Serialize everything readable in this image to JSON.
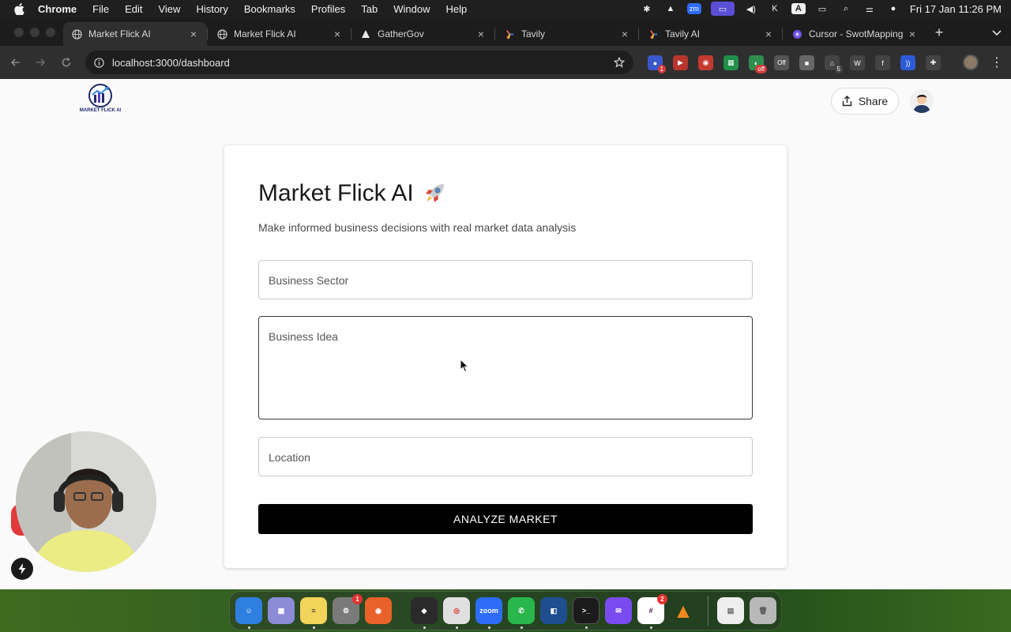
{
  "menubar": {
    "app_name": "Chrome",
    "menus": [
      "File",
      "Edit",
      "View",
      "History",
      "Bookmarks",
      "Profiles",
      "Tab",
      "Window",
      "Help"
    ],
    "status_icons": [
      "gear-icon",
      "vlc-icon",
      "zoom-icon",
      "screen-share-icon",
      "volume-icon",
      "k-icon",
      "a-icon",
      "battery-icon",
      "search-icon",
      "control-center-icon",
      "siri-icon"
    ],
    "clock": "Fri 17 Jan  11:26 PM"
  },
  "tabs": [
    {
      "title": "Market Flick AI",
      "favicon": "globe-icon",
      "active": true
    },
    {
      "title": "Market Flick AI",
      "favicon": "globe-icon",
      "active": false
    },
    {
      "title": "GatherGov",
      "favicon": "triangle-icon",
      "active": false
    },
    {
      "title": "Tavily",
      "favicon": "tavily-icon",
      "active": false
    },
    {
      "title": "Tavily AI",
      "favicon": "tavily-icon",
      "active": false
    },
    {
      "title": "Cursor - SwotMapping",
      "favicon": "cursor-icon",
      "active": false
    }
  ],
  "address_bar": {
    "url": "localhost:3000/dashboard"
  },
  "extensions": [
    {
      "name": "extension-icon",
      "badge": "1",
      "color": "#3a58c9"
    },
    {
      "name": "video-extension-icon",
      "badge": "",
      "color": "#b8342c"
    },
    {
      "name": "camera-extension-icon",
      "badge": "",
      "color": "#c43a2f"
    },
    {
      "name": "sheets-extension-icon",
      "badge": "",
      "color": "#1f8f4a"
    },
    {
      "name": "off-extension-icon",
      "badge": "off",
      "color": "#2f8d4e"
    },
    {
      "name": "off-toggle-extension-icon",
      "badge": "Off",
      "color": "#555555"
    },
    {
      "name": "box-extension-icon",
      "badge": "",
      "color": "#666666"
    },
    {
      "name": "home-extension-icon",
      "badge": "5",
      "color": "#555555"
    },
    {
      "name": "w-extension-icon",
      "badge": "",
      "color": "#555555"
    },
    {
      "name": "facebook-extension-icon",
      "badge": "",
      "color": "#555555"
    },
    {
      "name": "audio-extension-icon",
      "badge": "",
      "color": "#2d5bd6"
    },
    {
      "name": "puzzle-extension-icon",
      "badge": "",
      "color": "#555555"
    }
  ],
  "page": {
    "logo_text": "MARKET FLICK AI",
    "share_label": "Share",
    "card": {
      "title": "Market Flick AI",
      "subtitle": "Make informed business decisions with real market data analysis",
      "sector_placeholder": "Business Sector",
      "idea_placeholder": "Business Idea",
      "location_placeholder": "Location",
      "analyze_label": "ANALYZE MARKET"
    }
  },
  "dock": {
    "apps": [
      {
        "name": "finder-icon",
        "color": "#2f7fe0",
        "label": "",
        "badge": "",
        "running": true
      },
      {
        "name": "launchpad-icon",
        "color": "#8b8bd8",
        "label": "",
        "badge": "",
        "running": false
      },
      {
        "name": "notes-icon",
        "color": "#f3d45a",
        "label": "",
        "badge": "",
        "running": true
      },
      {
        "name": "system-settings-icon",
        "color": "#7a7a7a",
        "label": "",
        "badge": "1",
        "running": false
      },
      {
        "name": "firefox-icon",
        "color": "#e8622a",
        "label": "",
        "badge": "",
        "running": false
      },
      {
        "name": "cursor-app-icon",
        "color": "#2a2a2a",
        "label": "",
        "badge": "",
        "running": true
      },
      {
        "name": "chrome-icon",
        "color": "#e0e0e0",
        "label": "",
        "badge": "",
        "running": true
      },
      {
        "name": "zoom-app-icon",
        "color": "#2d6cf6",
        "label": "zoom",
        "badge": "",
        "running": true
      },
      {
        "name": "whatsapp-icon",
        "color": "#29b74b",
        "label": "",
        "badge": "",
        "running": true
      },
      {
        "name": "code-app-icon",
        "color": "#1f4e8f",
        "label": "",
        "badge": "",
        "running": false
      },
      {
        "name": "terminal-icon",
        "color": "#1b1b1b",
        "label": ">_",
        "badge": "",
        "running": true
      },
      {
        "name": "messenger-icon",
        "color": "#7a4cf0",
        "label": "",
        "badge": "",
        "running": false
      },
      {
        "name": "slack-icon",
        "color": "#ffffff",
        "label": "",
        "badge": "2",
        "running": true
      },
      {
        "name": "vlc-app-icon",
        "color": "#f08a1e",
        "label": "",
        "badge": "",
        "running": false
      },
      {
        "name": "document-icon",
        "color": "#eeeeee",
        "label": "",
        "badge": "",
        "running": false
      },
      {
        "name": "trash-icon",
        "color": "#b8b8b8",
        "label": "",
        "badge": "",
        "running": false
      }
    ]
  }
}
